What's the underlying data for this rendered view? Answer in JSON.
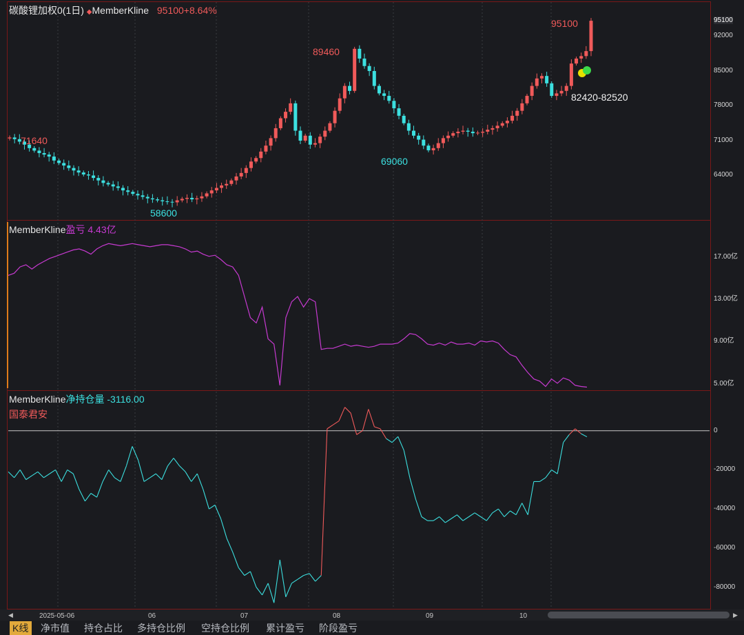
{
  "kline": {
    "title": "碳酸锂加权0(1日)",
    "indicator_marker": "◆",
    "indicator_name": "MemberKline",
    "last_value": "95100+8.64%",
    "annotations": {
      "high_label": "89460",
      "low_label": "58600",
      "start_label": "71640",
      "mid_low_label": "69060",
      "last_high_label": "95100",
      "range_label": "82420-82520"
    },
    "y_ticks": [
      "95100",
      "92000",
      "85000",
      "78000",
      "71000",
      "64000"
    ]
  },
  "profit": {
    "name": "MemberKline",
    "label": "盈亏",
    "value": "4.43亿",
    "y_ticks": [
      "17.00亿",
      "13.00亿",
      "9.00亿",
      "5.00亿"
    ],
    "series": [
      15.0,
      15.2,
      15.8,
      16.0,
      15.6,
      16.0,
      16.3,
      16.6,
      16.8,
      17.0,
      17.2,
      17.4,
      17.5,
      17.3,
      17.0,
      17.5,
      17.8,
      18.0,
      17.9,
      17.8,
      17.9,
      18.0,
      17.9,
      17.8,
      17.7,
      17.8,
      17.9,
      17.9,
      17.8,
      17.7,
      17.5,
      17.2,
      17.3,
      17.0,
      16.8,
      16.9,
      16.5,
      16.0,
      15.8,
      15.0,
      13.0,
      11.0,
      10.5,
      12.0,
      9.0,
      8.5,
      4.6,
      11.0,
      12.5,
      13.0,
      12.0,
      12.8,
      12.5,
      8.0,
      8.1,
      8.1,
      8.3,
      8.5,
      8.3,
      8.4,
      8.3,
      8.2,
      8.3,
      8.5,
      8.5,
      8.5,
      8.6,
      9.0,
      9.5,
      9.4,
      9.0,
      8.5,
      8.4,
      8.6,
      8.4,
      8.7,
      8.5,
      8.5,
      8.6,
      8.4,
      8.8,
      8.7,
      8.8,
      8.6,
      8.0,
      7.5,
      7.3,
      6.5,
      5.8,
      5.2,
      5.0,
      4.5,
      5.2,
      4.8,
      5.3,
      5.1,
      4.6,
      4.5,
      4.43
    ],
    "color": "#c73ad1"
  },
  "position": {
    "name": "MemberKline",
    "label": "净持仓量",
    "value": "-3116.00",
    "member": "国泰君安",
    "y_ticks": [
      "0",
      "-20000",
      "-40000",
      "-60000",
      "-80000"
    ],
    "series": [
      -21000,
      -24000,
      -20000,
      -25000,
      -23000,
      -21000,
      -24000,
      -22000,
      -20000,
      -26000,
      -20000,
      -22000,
      -30000,
      -36000,
      -32000,
      -34000,
      -26000,
      -20000,
      -24000,
      -26000,
      -18000,
      -8000,
      -15000,
      -26000,
      -24000,
      -22000,
      -25000,
      -18000,
      -14000,
      -18000,
      -21000,
      -26000,
      -22000,
      -30000,
      -40000,
      -38000,
      -45000,
      -55000,
      -62000,
      -70000,
      -74000,
      -72000,
      -80000,
      -84000,
      -78000,
      -88000,
      -66000,
      -85000,
      -78000,
      -76000,
      -74000,
      -73000,
      -77000,
      -74000,
      1000,
      3000,
      5000,
      12000,
      9000,
      -2000,
      0,
      11000,
      2000,
      1000,
      -4000,
      -6000,
      -3000,
      -10000,
      -24000,
      -35000,
      -44000,
      -46000,
      -46000,
      -44000,
      -47000,
      -45000,
      -43000,
      -46000,
      -44000,
      -42000,
      -44000,
      -46000,
      -42000,
      -40000,
      -44000,
      -41000,
      -43000,
      -37000,
      -43000,
      -26000,
      -26000,
      -24000,
      -20000,
      -22000,
      -6000,
      -2000,
      1000,
      -1500,
      -3116
    ],
    "zero_color": "#c9c9c9",
    "up_color": "#f05a5a",
    "down_color": "#3ce0e0"
  },
  "x_axis": {
    "labels": [
      "2025-05-06",
      "06",
      "07",
      "08",
      "09",
      "10"
    ]
  },
  "tabs": [
    {
      "label": "K线",
      "active": true
    },
    {
      "label": "净市值",
      "active": false
    },
    {
      "label": "持仓占比",
      "active": false
    },
    {
      "label": "多持仓比例",
      "active": false
    },
    {
      "label": "空持仓比例",
      "active": false
    },
    {
      "label": "累计盈亏",
      "active": false
    },
    {
      "label": "阶段盈亏",
      "active": false
    }
  ],
  "chart_data": {
    "type": "line",
    "title": "碳酸锂加权0(1日)",
    "candles_close": [
      71640,
      71300,
      70800,
      70200,
      69500,
      69000,
      68500,
      68200,
      67800,
      67000,
      66500,
      66000,
      65500,
      65000,
      64600,
      64200,
      64000,
      63500,
      63000,
      62500,
      62200,
      61800,
      61500,
      61000,
      60700,
      60300,
      60000,
      59700,
      59400,
      59200,
      59000,
      58800,
      58700,
      58600,
      59000,
      59300,
      59500,
      59200,
      59400,
      59800,
      60400,
      61000,
      61500,
      62000,
      62300,
      63000,
      63800,
      64500,
      65500,
      66800,
      67500,
      68800,
      70000,
      71500,
      73500,
      75500,
      76800,
      78500,
      73000,
      71000,
      72000,
      70200,
      70500,
      71800,
      73000,
      74500,
      77000,
      79500,
      82000,
      81000,
      89460,
      87500,
      86000,
      85000,
      82000,
      80500,
      80000,
      79000,
      77500,
      76000,
      74500,
      73000,
      72000,
      71200,
      70000,
      69060,
      69500,
      70500,
      71500,
      72000,
      72500,
      72800,
      73000,
      72800,
      72500,
      72600,
      72800,
      73200,
      73500,
      74000,
      74500,
      75000,
      76000,
      77000,
      78500,
      80000,
      82000,
      83500,
      84000,
      82520,
      80000,
      80500,
      81000,
      82000,
      86500,
      87500,
      88000,
      89000,
      95100
    ]
  }
}
